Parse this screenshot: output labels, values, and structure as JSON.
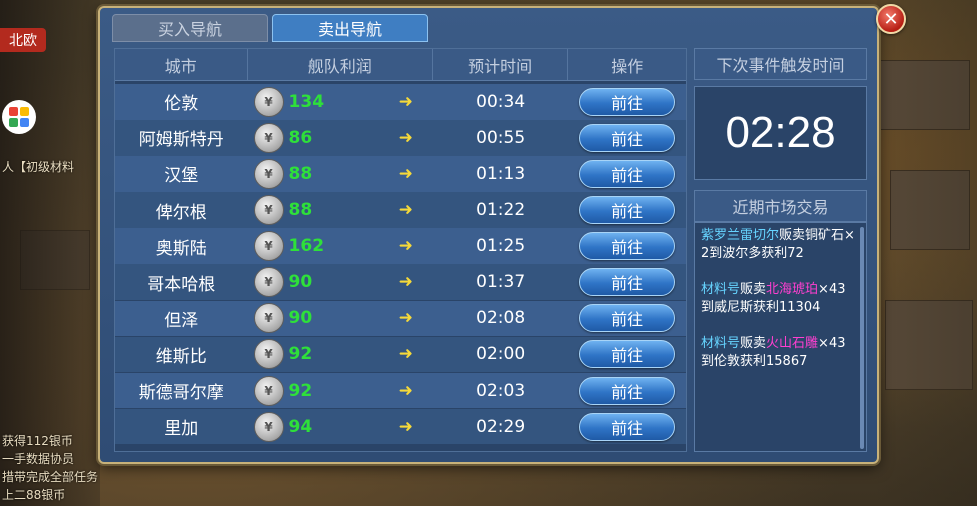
{
  "background": {
    "left_tag": "北欧",
    "left_texts": [
      "人【初级材料",
      "获得112银币",
      "一手数据协员",
      "措带完成全部任务",
      "上二88银币"
    ]
  },
  "tabs": [
    {
      "label": "买入导航",
      "active": false
    },
    {
      "label": "卖出导航",
      "active": true
    }
  ],
  "close_icon": "✕",
  "table": {
    "headers": [
      "城市",
      "舰队利润",
      "预计时间",
      "操作"
    ],
    "rows": [
      {
        "city": "伦敦",
        "profit": "134",
        "time": "00:34",
        "action": "前往"
      },
      {
        "city": "阿姆斯特丹",
        "profit": "86",
        "time": "00:55",
        "action": "前往"
      },
      {
        "city": "汉堡",
        "profit": "88",
        "time": "01:13",
        "action": "前往"
      },
      {
        "city": "俾尔根",
        "profit": "88",
        "time": "01:22",
        "action": "前往"
      },
      {
        "city": "奥斯陆",
        "profit": "162",
        "time": "01:25",
        "action": "前往"
      },
      {
        "city": "哥本哈根",
        "profit": "90",
        "time": "01:37",
        "action": "前往"
      },
      {
        "city": "但泽",
        "profit": "90",
        "time": "02:08",
        "action": "前往"
      },
      {
        "city": "维斯比",
        "profit": "92",
        "time": "02:00",
        "action": "前往"
      },
      {
        "city": "斯德哥尔摩",
        "profit": "92",
        "time": "02:03",
        "action": "前往"
      },
      {
        "city": "里加",
        "profit": "94",
        "time": "02:29",
        "action": "前往"
      }
    ]
  },
  "next_event": {
    "title": "下次事件触发时间",
    "countdown": "02:28"
  },
  "market": {
    "title": "近期市场交易",
    "trades": [
      {
        "who": "紫罗兰雷切尔",
        "verb": "贩卖铜矿石×2到波尔多获利72",
        "goods": ""
      },
      {
        "who": "材料号",
        "verb": "贩卖",
        "goods": "北海琥珀",
        "rest": "×43到威尼斯获利11304"
      },
      {
        "who": "材料号",
        "verb": "贩卖",
        "goods": "火山石雕",
        "rest": "×43到伦敦获利15867"
      }
    ]
  },
  "colors": {
    "profit": "#2ee03a",
    "arrow": "#f5d93a",
    "trader": "#66d4ff",
    "goods": "#ff3fd0",
    "button": "#2f74c6"
  }
}
